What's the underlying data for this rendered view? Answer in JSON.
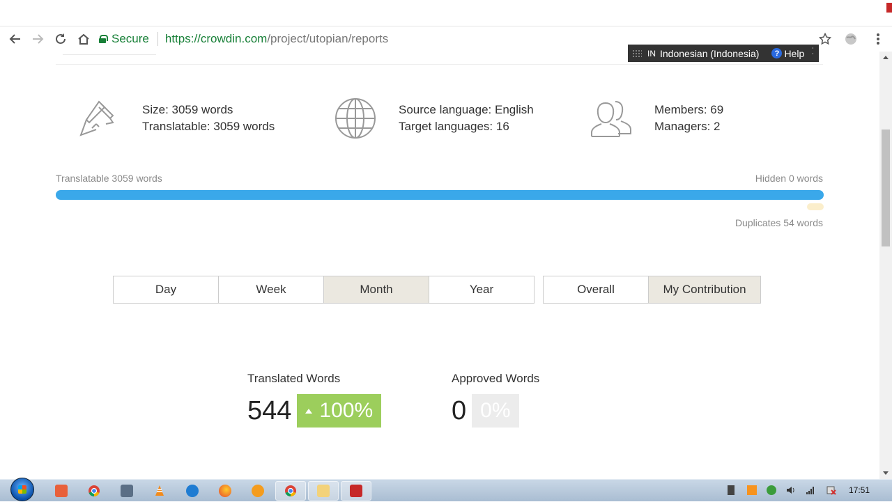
{
  "browser": {
    "secure_label": "Secure",
    "url_host": "https://crowdin.com",
    "url_path": "/project/utopian/reports"
  },
  "language_bar": {
    "code": "IN",
    "language": "Indonesian (Indonesia)",
    "help_label": "Help"
  },
  "project_stats": {
    "size": "Size: 3059 words",
    "translatable": "Translatable: 3059 words",
    "source_language": "Source language: English",
    "target_languages": "Target languages: 16",
    "members": "Members: 69",
    "managers": "Managers: 2"
  },
  "progress": {
    "translatable_label": "Translatable 3059 words",
    "hidden_label": "Hidden 0 words",
    "duplicates_label": "Duplicates 54 words",
    "translatable_words": 3059,
    "hidden_words": 0,
    "duplicate_words": 54
  },
  "period_tabs": [
    "Day",
    "Week",
    "Month",
    "Year"
  ],
  "period_active": "Month",
  "scope_tabs": [
    "Overall",
    "My Contribution"
  ],
  "scope_active": "My Contribution",
  "metrics": {
    "translated": {
      "title": "Translated Words",
      "value": "544",
      "change": "100%"
    },
    "approved": {
      "title": "Approved Words",
      "value": "0",
      "change": "0%"
    }
  },
  "taskbar": {
    "time": "17:51"
  },
  "colors": {
    "progress_blue": "#3aa8ea",
    "badge_green": "#9cce5c",
    "secure_green": "#188038",
    "active_tab": "#ebe8e0"
  }
}
